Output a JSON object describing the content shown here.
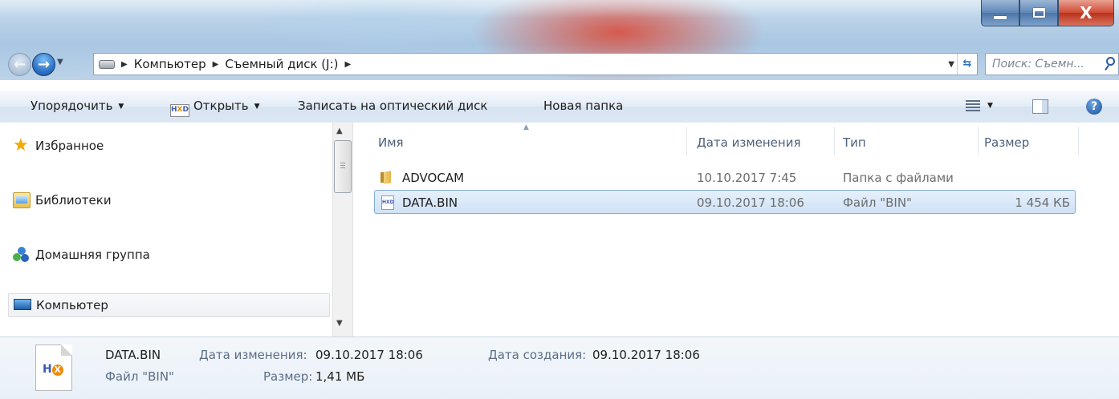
{
  "window": {
    "close_glyph": "X"
  },
  "navigation": {
    "breadcrumb": [
      "Компьютер",
      "Съемный диск (J:)"
    ],
    "search_placeholder": "Поиск: Съемн..."
  },
  "toolbar": {
    "organize": "Упорядочить",
    "open": "Открыть",
    "burn": "Записать на оптический диск",
    "new_folder": "Новая папка",
    "help_glyph": "?"
  },
  "nav_pane": {
    "items": [
      {
        "label": "Избранное",
        "icon": "star-icon"
      },
      {
        "label": "Библиотеки",
        "icon": "libraries-icon"
      },
      {
        "label": "Домашняя группа",
        "icon": "homegroup-icon"
      },
      {
        "label": "Компьютер",
        "icon": "computer-icon",
        "selected": true
      }
    ]
  },
  "file_list": {
    "columns": [
      "Имя",
      "Дата изменения",
      "Тип",
      "Размер"
    ],
    "rows": [
      {
        "name": "ADVOCAM",
        "modified": "10.10.2017 7:45",
        "type": "Папка с файлами",
        "size": "",
        "icon": "folder-icon"
      },
      {
        "name": "DATA.BIN",
        "modified": "09.10.2017 18:06",
        "type": "Файл \"BIN\"",
        "size": "1 454 КБ",
        "icon": "hxd-file-icon",
        "selected": true
      }
    ]
  },
  "details": {
    "name": "DATA.BIN",
    "type": "Файл \"BIN\"",
    "modified_label": "Дата изменения:",
    "modified_value": "09.10.2017 18:06",
    "created_label": "Дата создания:",
    "created_value": "09.10.2017 18:06",
    "size_label": "Размер:",
    "size_value": "1,41 МБ"
  },
  "colors": {
    "selection_border": "#84acdd",
    "selection_fill": "#cfe2f7",
    "close_button": "#cf4a33"
  }
}
